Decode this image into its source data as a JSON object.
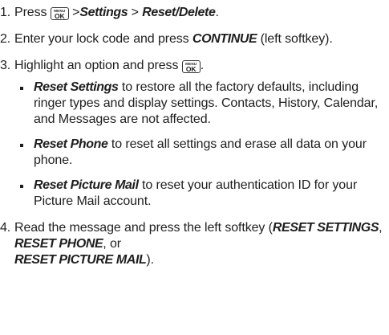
{
  "key_icon": {
    "menu": "MENU",
    "ok": "OK"
  },
  "steps": [
    {
      "num": "1.",
      "a": "Press ",
      "b": " >",
      "c": "Settings",
      "d": " > ",
      "e": "Reset/Delete",
      "f": "."
    },
    {
      "num": "2.",
      "a": "Enter your lock code and press ",
      "b": "CONTINUE",
      "c": " (left softkey)."
    },
    {
      "num": "3.",
      "a": "Highlight an option and press ",
      "b": ".",
      "bullets": [
        {
          "label": "Reset Settings",
          "text": " to restore all the factory defaults, including ringer types and display settings. Contacts, History, Calendar, and Messages are not affected."
        },
        {
          "label": "Reset Phone",
          "text": " to reset all settings and erase all data on your phone."
        },
        {
          "label": "Reset Picture Mail",
          "text": " to reset your authentication ID for your Picture Mail account."
        }
      ]
    },
    {
      "num": "4.",
      "a": "Read the message and press the left softkey (",
      "b": "RESET SETTINGS",
      "c": ", ",
      "d": "RESET PHONE",
      "e": ", or ",
      "f": "RESET PICTURE MAIL",
      "g": ")."
    }
  ]
}
